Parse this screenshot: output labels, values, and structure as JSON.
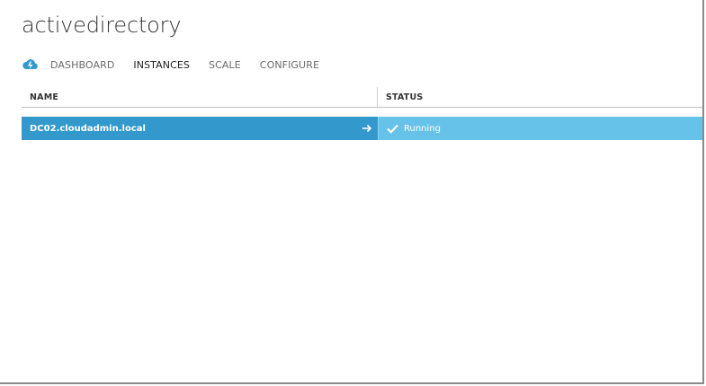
{
  "header": {
    "title": "activedirectory"
  },
  "nav": {
    "icon": "cloud-service-icon",
    "tabs": [
      {
        "label": "DASHBOARD",
        "active": false
      },
      {
        "label": "INSTANCES",
        "active": true
      },
      {
        "label": "SCALE",
        "active": false
      },
      {
        "label": "CONFIGURE",
        "active": false
      }
    ]
  },
  "grid": {
    "columns": {
      "name": "NAME",
      "status": "STATUS"
    },
    "rows": [
      {
        "name": "DC02.cloudadmin.local",
        "status": "Running",
        "selected": true
      }
    ]
  },
  "colors": {
    "selected_row": "#3399cc",
    "selected_row_light": "#66c2e9",
    "accent": "#3399cc"
  }
}
